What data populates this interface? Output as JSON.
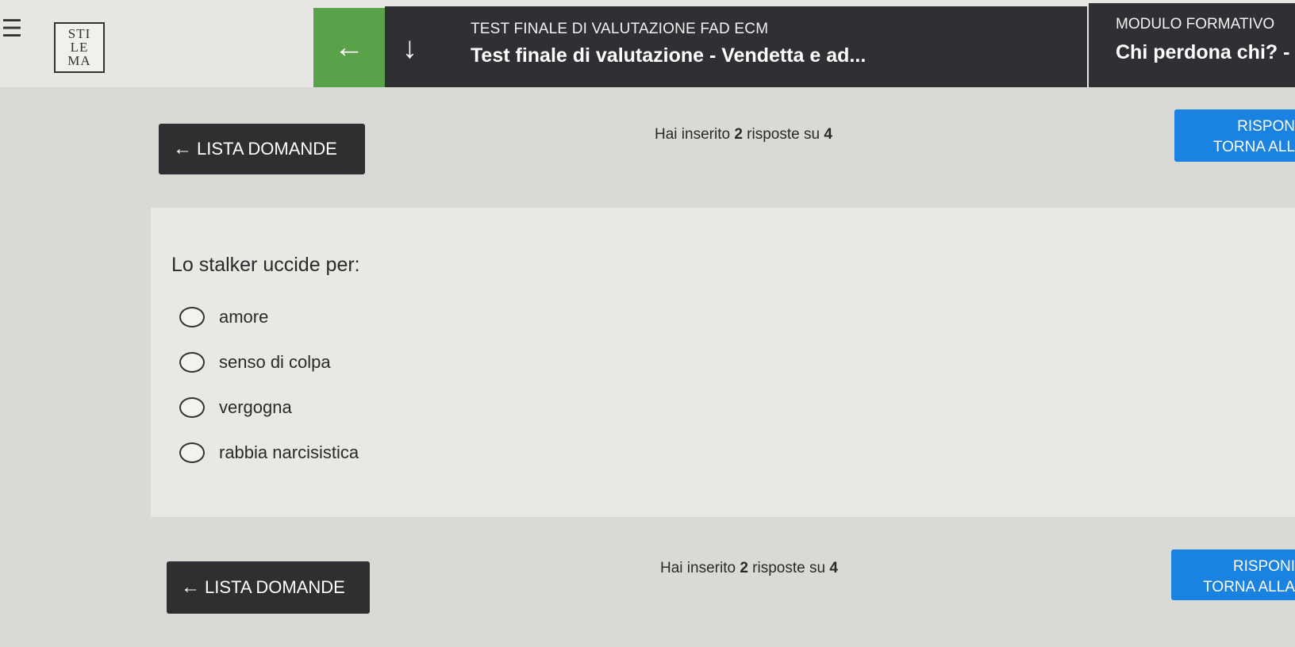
{
  "header": {
    "menu_icon": "hamburger-icon",
    "logo_lines": [
      "STI",
      "LE",
      "MA"
    ],
    "back_icon": "arrow-left-icon",
    "down_icon": "arrow-down-icon",
    "course_subtitle": "TEST FINALE DI VALUTAZIONE FAD ECM",
    "course_title": "Test finale di valutazione - Vendetta e ad...",
    "module_subtitle": "MODULO FORMATIVO",
    "module_title": "Chi perdona chi? -",
    "colors": {
      "back_button": "#5aa24a",
      "header_dark": "#2f3033"
    }
  },
  "nav_top": {
    "list_label": "LISTA DOMANDE",
    "status_prefix": "Hai inserito ",
    "status_count": "2",
    "status_suffix": " risposte su ",
    "status_total": "4",
    "answer_line1": "RISPON",
    "answer_line2": "TORNA ALL"
  },
  "question": {
    "text": "Lo stalker uccide per:",
    "options": [
      "amore",
      "senso di colpa",
      "vergogna",
      "rabbia narcisistica"
    ]
  },
  "nav_bottom": {
    "list_label": "LISTA DOMANDE",
    "status_prefix": "Hai inserito ",
    "status_count": "2",
    "status_suffix": " risposte su ",
    "status_total": "4",
    "answer_line1": "RISPONI",
    "answer_line2": "TORNA ALLA"
  },
  "colors": {
    "accent_blue": "#1a82e0",
    "button_dark": "#2e2f31"
  }
}
